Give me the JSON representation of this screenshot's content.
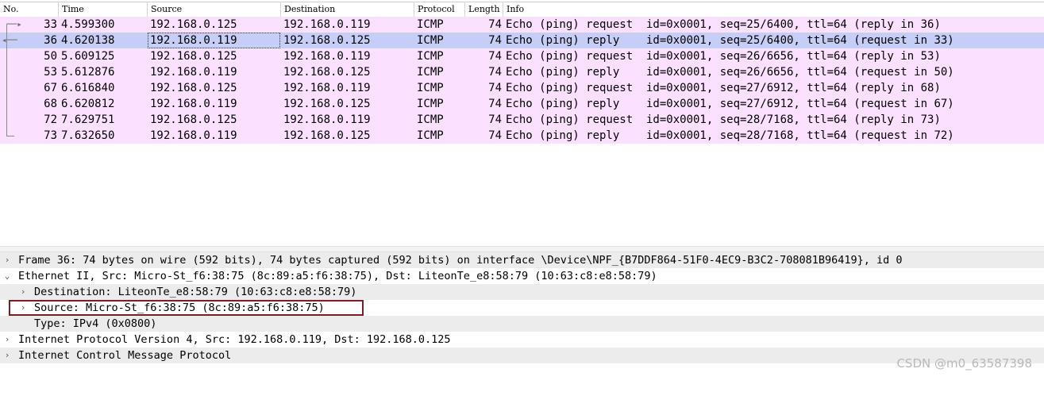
{
  "columns": {
    "no": "No.",
    "time": "Time",
    "source": "Source",
    "destination": "Destination",
    "protocol": "Protocol",
    "length": "Length",
    "info": "Info"
  },
  "packets": [
    {
      "no": "33",
      "time": "4.599300",
      "src": "192.168.0.125",
      "dst": "192.168.0.119",
      "proto": "ICMP",
      "len": "74",
      "info": "Echo (ping) request  id=0x0001, seq=25/6400, ttl=64 (reply in 36)"
    },
    {
      "no": "36",
      "time": "4.620138",
      "src": "192.168.0.119",
      "dst": "192.168.0.125",
      "proto": "ICMP",
      "len": "74",
      "info": "Echo (ping) reply    id=0x0001, seq=25/6400, ttl=64 (request in 33)"
    },
    {
      "no": "50",
      "time": "5.609125",
      "src": "192.168.0.125",
      "dst": "192.168.0.119",
      "proto": "ICMP",
      "len": "74",
      "info": "Echo (ping) request  id=0x0001, seq=26/6656, ttl=64 (reply in 53)"
    },
    {
      "no": "53",
      "time": "5.612876",
      "src": "192.168.0.119",
      "dst": "192.168.0.125",
      "proto": "ICMP",
      "len": "74",
      "info": "Echo (ping) reply    id=0x0001, seq=26/6656, ttl=64 (request in 50)"
    },
    {
      "no": "67",
      "time": "6.616840",
      "src": "192.168.0.125",
      "dst": "192.168.0.119",
      "proto": "ICMP",
      "len": "74",
      "info": "Echo (ping) request  id=0x0001, seq=27/6912, ttl=64 (reply in 68)"
    },
    {
      "no": "68",
      "time": "6.620812",
      "src": "192.168.0.119",
      "dst": "192.168.0.125",
      "proto": "ICMP",
      "len": "74",
      "info": "Echo (ping) reply    id=0x0001, seq=27/6912, ttl=64 (request in 67)"
    },
    {
      "no": "72",
      "time": "7.629751",
      "src": "192.168.0.125",
      "dst": "192.168.0.119",
      "proto": "ICMP",
      "len": "74",
      "info": "Echo (ping) request  id=0x0001, seq=28/7168, ttl=64 (reply in 73)"
    },
    {
      "no": "73",
      "time": "7.632650",
      "src": "192.168.0.119",
      "dst": "192.168.0.125",
      "proto": "ICMP",
      "len": "74",
      "info": "Echo (ping) reply    id=0x0001, seq=28/7168, ttl=64 (request in 72)"
    }
  ],
  "selected_packet": "36",
  "details": [
    {
      "text": "Frame 36: 74 bytes on wire (592 bits), 74 bytes captured (592 bits) on interface \\Device\\NPF_{B7DDF864-51F0-4EC9-B3C2-708081B96419}, id 0",
      "expander": "chevron-right-icon"
    },
    {
      "text": "Ethernet II, Src: Micro-St_f6:38:75 (8c:89:a5:f6:38:75), Dst: LiteonTe_e8:58:79 (10:63:c8:e8:58:79)",
      "expander": "chevron-down-icon"
    },
    {
      "text": "Destination: LiteonTe_e8:58:79 (10:63:c8:e8:58:79)",
      "expander": "chevron-right-icon"
    },
    {
      "text": "Source: Micro-St_f6:38:75 (8c:89:a5:f6:38:75)",
      "expander": "chevron-right-icon"
    },
    {
      "text": "Type: IPv4 (0x0800)",
      "expander": "none"
    },
    {
      "text": "Internet Protocol Version 4, Src: 192.168.0.119, Dst: 192.168.0.125",
      "expander": "chevron-right-icon"
    },
    {
      "text": "Internet Control Message Protocol",
      "expander": "chevron-right-icon"
    }
  ],
  "watermark": "CSDN @m0_63587398",
  "colors": {
    "icmp_row": "#fce0ff",
    "selected_row": "#c6cdf6",
    "highlight_box": "#7b1f27"
  }
}
